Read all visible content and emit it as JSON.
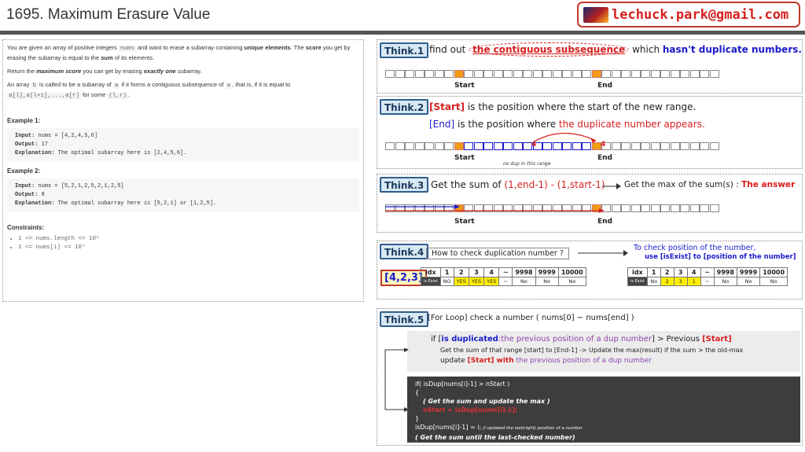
{
  "header": {
    "title": "1695. Maximum Erasure Value",
    "email": "lechuck.park@gmail.com"
  },
  "problem": {
    "p1a": "You are given an array of positive integers ",
    "p1code": "nums",
    "p1b": " and want to erase a subarray containing ",
    "p1bold": "unique elements",
    "p1c": ". The ",
    "p1score": "score",
    "p1d": " you get by erasing the subarray is equal to the ",
    "p1sum": "sum",
    "p1e": " of its elements.",
    "p2a": "Return the ",
    "p2b": "maximum score",
    "p2c": " you can get by erasing ",
    "p2d": "exactly one",
    "p2e": " subarray.",
    "p3a": "An array ",
    "p3b": "b",
    "p3c": " is called to be a subarray of ",
    "p3d": "a",
    "p3e": " if it forms a contiguous subsequence of ",
    "p3f": "a",
    "p3g": ", that is, if it is equal to ",
    "p3h": "a[l],a[l+1],...,a[r]",
    "p3i": " for some ",
    "p3j": "(l,r)",
    "p3k": ".",
    "ex1_title": "Example 1:",
    "ex1_in_l": "Input:",
    "ex1_in": " nums = [4,2,4,5,6]",
    "ex1_out_l": "Output:",
    "ex1_out": " 17",
    "ex1_exp_l": "Explanation:",
    "ex1_exp": " The optimal subarray here is [2,4,5,6].",
    "ex2_title": "Example 2:",
    "ex2_in_l": "Input:",
    "ex2_in": " nums = [5,2,1,2,5,2,1,2,5]",
    "ex2_out_l": "Output:",
    "ex2_out": " 8",
    "ex2_exp_l": "Explanation:",
    "ex2_exp": " The optimal subarray here is [5,2,1] or [1,2,5].",
    "cons_title": "Constraints:",
    "cons1": "1 <= nums.length <= 10⁵",
    "cons2": "1 <= nums[i] <= 10⁴"
  },
  "think1": {
    "tag": "Think.1",
    "a": "find out ",
    "b": "the contiguous subsequence",
    "c": " which ",
    "d": "hasn't duplicate numbers.",
    "start": "Start",
    "end": "End"
  },
  "think2": {
    "tag": "Think.2",
    "s": "[Start]",
    "l1": " is the position where the start of the new range.",
    "e": "[End]",
    "l2a": " is the position where ",
    "l2b": "the duplicate number appears.",
    "n1": "4",
    "n2": "4",
    "start": "Start",
    "end": "End",
    "note": "no dup in this range"
  },
  "think3": {
    "tag": "Think.3",
    "a": "Get the sum of ",
    "b": "(1,end-1) - (1,start-1)",
    "c": "Get the max of the sum(s) : ",
    "d": "The answer",
    "start": "Start",
    "end": "End"
  },
  "think4": {
    "tag": "Think.4",
    "q": "How to check duplication number ?",
    "arr": "[4,2,3]",
    "r1": "To check position of the number,",
    "r2": "use [isExist] to [position of the number]",
    "t1h": [
      "idx",
      "1",
      "2",
      "3",
      "4",
      "~",
      "9998",
      "9999",
      "10000"
    ],
    "t1r": [
      "is Exist",
      "NO",
      "YES",
      "YES",
      "YES",
      "~",
      "No",
      "No",
      "No"
    ],
    "t2h": [
      "idx",
      "1",
      "2",
      "3",
      "4",
      "~",
      "9998",
      "9999",
      "10000"
    ],
    "t2r": [
      "is Exist",
      "No",
      "2",
      "3",
      "1",
      "~",
      "No",
      "No",
      "No"
    ]
  },
  "think5": {
    "tag": "Think.5",
    "title": "[For Loop] check a number ( nums[0] ~ nums[end] )",
    "if_a": "if [",
    "if_b": "is duplicated",
    "if_c": ":the previous position of a dup number",
    "if_d": "] > Previous ",
    "if_e": "[Start]",
    "line2": "Get the sum of that range [start] to [End-1] -> Update the max(result) if the sum > the old-max",
    "line3a": "update ",
    "line3b": "[Start] with",
    "line3c": " the previous position of a dup number",
    "c1": "if( isDup[nums[i]-1] > nStart )",
    "c2": "{",
    "c3": "( Get the sum and update the max )",
    "c4": "nStart = isDup[nums[i]-1];",
    "c5": "}",
    "c6a": "isDup[nums[i]-1] = i;",
    "c6b": " // updated the last(right) position of a number",
    "c7": "( Get the sum until the last-checked number)"
  }
}
